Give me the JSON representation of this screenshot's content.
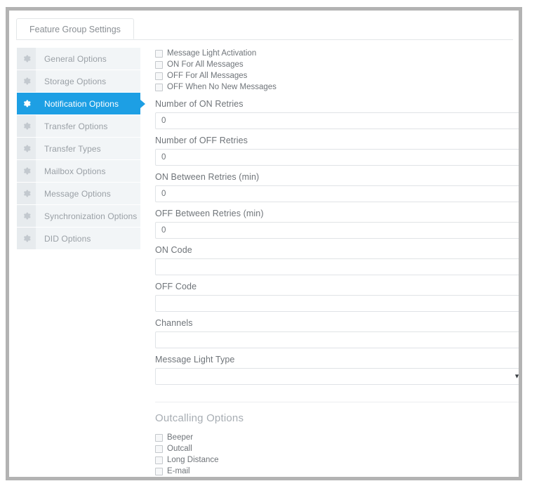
{
  "frame": {
    "border_color": "#b3b3b3",
    "accent_color": "#1d9fe4"
  },
  "tabs": [
    {
      "label": "Feature Group Settings",
      "active": true
    }
  ],
  "sidebar": {
    "icon_name": "gear-icon",
    "items": [
      {
        "label": "General Options",
        "active": false
      },
      {
        "label": "Storage Options",
        "active": false
      },
      {
        "label": "Notification Options",
        "active": true
      },
      {
        "label": "Transfer Options",
        "active": false
      },
      {
        "label": "Transfer Types",
        "active": false
      },
      {
        "label": "Mailbox Options",
        "active": false
      },
      {
        "label": "Message Options",
        "active": false
      },
      {
        "label": "Synchronization Options",
        "active": false
      },
      {
        "label": "DID Options",
        "active": false
      }
    ]
  },
  "main": {
    "message_light_checkboxes": [
      {
        "label": "Message Light Activation",
        "checked": false
      },
      {
        "label": "ON For All Messages",
        "checked": false
      },
      {
        "label": "OFF For All Messages",
        "checked": false
      },
      {
        "label": "OFF When No New Messages",
        "checked": false
      }
    ],
    "fields": [
      {
        "label": "Number of ON Retries",
        "value": "0",
        "placeholder": ""
      },
      {
        "label": "Number of OFF Retries",
        "value": "0",
        "placeholder": ""
      },
      {
        "label": "ON Between Retries (min)",
        "value": "0",
        "placeholder": ""
      },
      {
        "label": "OFF Between Retries (min)",
        "value": "0",
        "placeholder": ""
      },
      {
        "label": "ON Code",
        "value": "",
        "placeholder": ""
      },
      {
        "label": "OFF Code",
        "value": "",
        "placeholder": ""
      },
      {
        "label": "Channels",
        "value": "",
        "placeholder": ""
      }
    ],
    "message_light_type": {
      "label": "Message Light Type",
      "selected": "",
      "caret_icon": "chevron-down-icon",
      "options": [
        ""
      ]
    },
    "outcalling": {
      "title": "Outcalling Options",
      "checkboxes": [
        {
          "label": "Beeper",
          "checked": false
        },
        {
          "label": "Outcall",
          "checked": false
        },
        {
          "label": "Long Distance",
          "checked": false
        },
        {
          "label": "E-mail",
          "checked": false
        }
      ]
    }
  }
}
